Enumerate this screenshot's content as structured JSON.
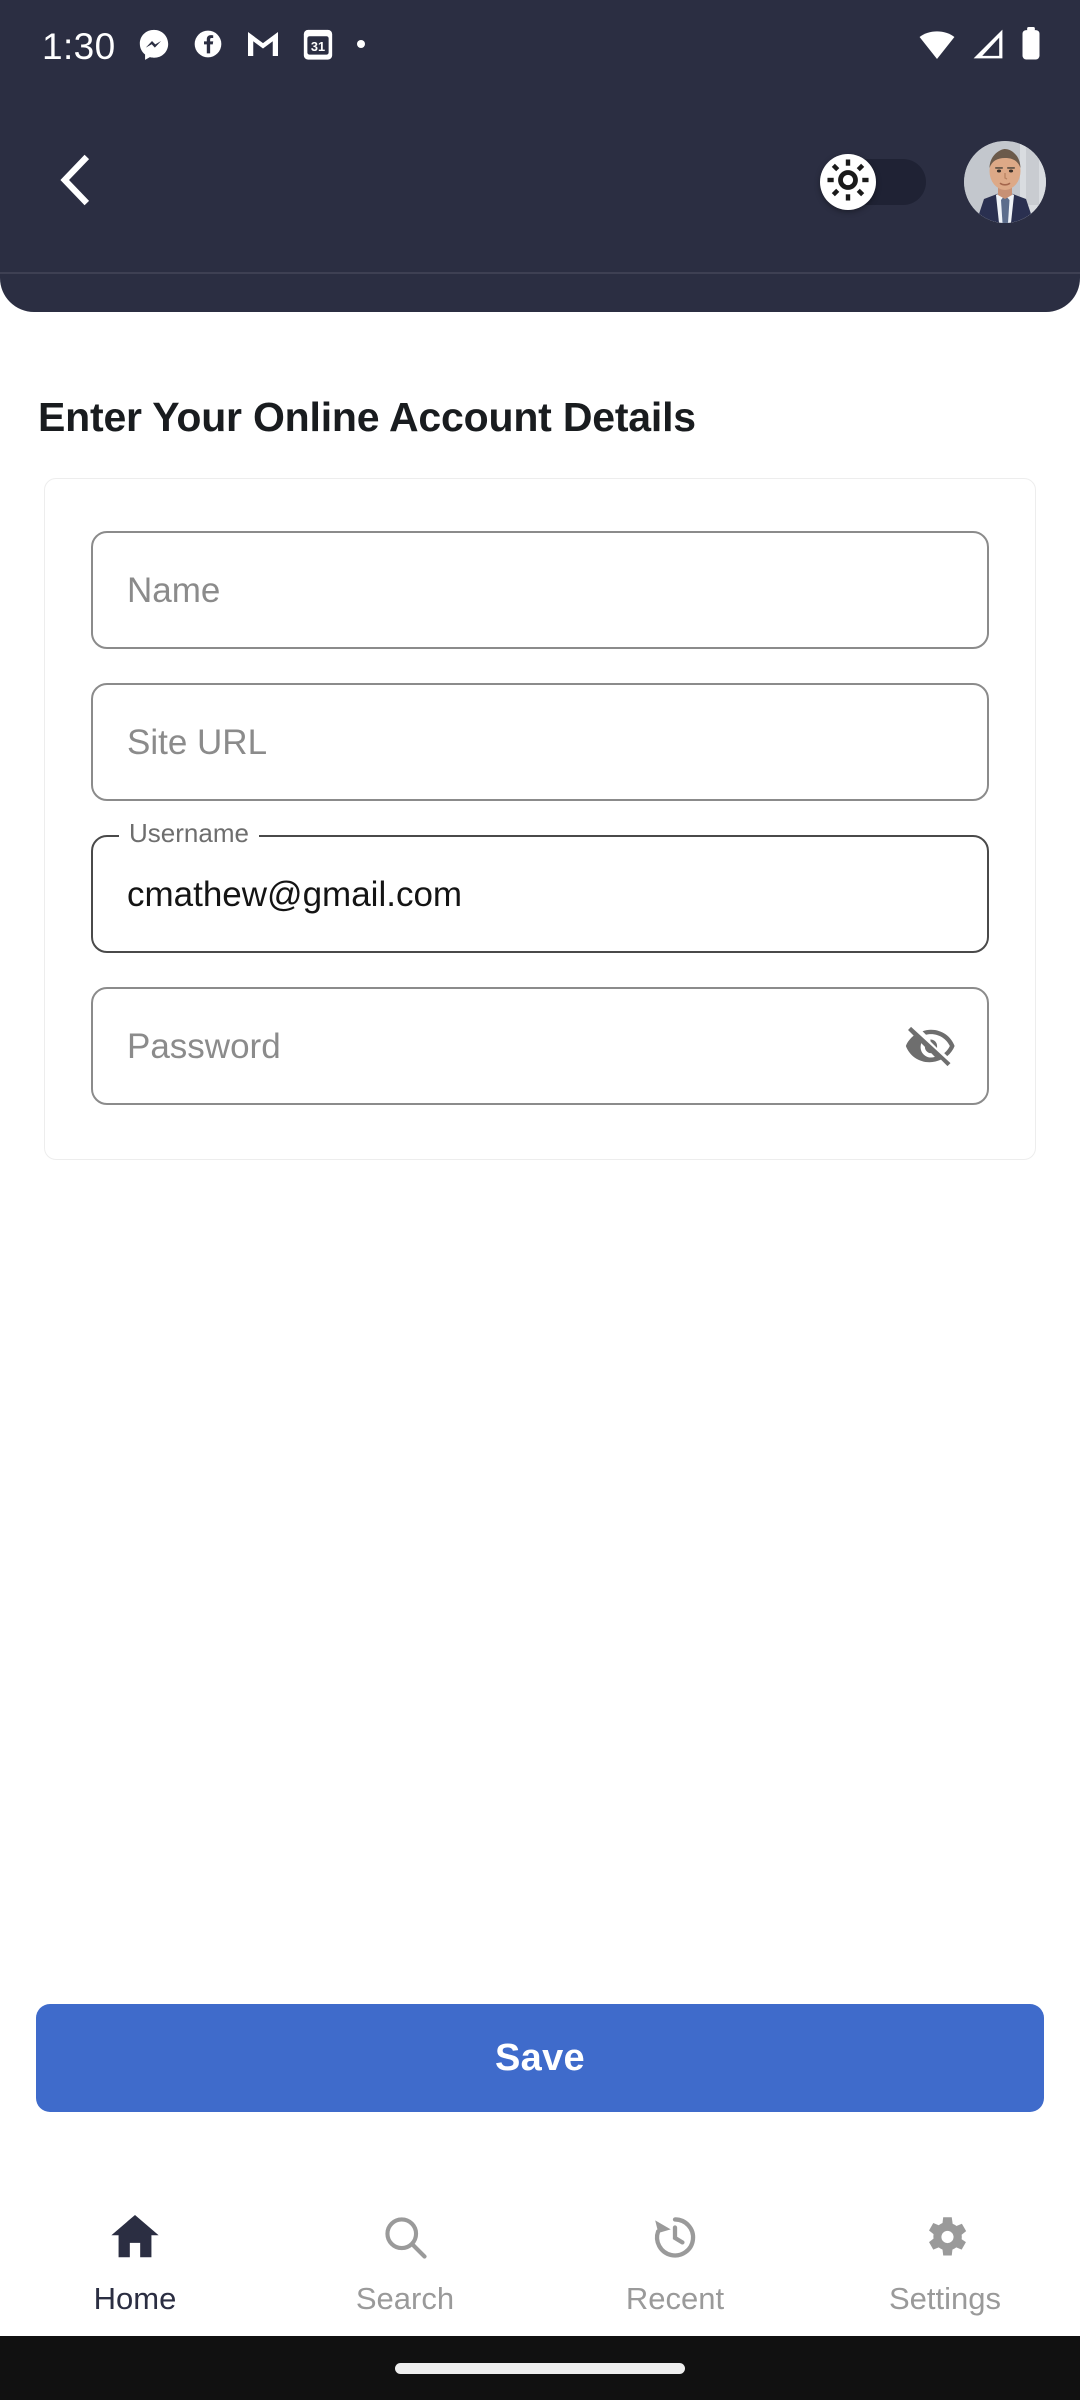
{
  "status_bar": {
    "time": "1:30",
    "left_icons": [
      "messenger-icon",
      "facebook-icon",
      "gmail-icon",
      "calendar-icon",
      "more-dot-icon"
    ],
    "calendar_day": "31",
    "right_icons": [
      "wifi-icon",
      "cellular-signal-icon",
      "battery-icon"
    ]
  },
  "app_bar": {
    "back_icon": "back-chevron-icon",
    "theme_toggle": {
      "icon": "brightness-sun-icon",
      "state": "off"
    },
    "avatar": "user-avatar"
  },
  "main": {
    "title": "Enter Your Online Account Details",
    "fields": [
      {
        "name": "name",
        "placeholder": "Name",
        "value": "",
        "label": "",
        "floating": false
      },
      {
        "name": "site-url",
        "placeholder": "Site URL",
        "value": "",
        "label": "",
        "floating": false
      },
      {
        "name": "username",
        "placeholder": "",
        "value": "cmathew@gmail.com",
        "label": "Username",
        "floating": true
      },
      {
        "name": "password",
        "placeholder": "Password",
        "value": "",
        "label": "",
        "floating": false,
        "trailing_icon": "visibility-off-icon"
      }
    ]
  },
  "actions": {
    "save_label": "Save"
  },
  "bottom_nav": {
    "items": [
      {
        "label": "Home",
        "icon": "home-icon",
        "active": true
      },
      {
        "label": "Search",
        "icon": "search-icon",
        "active": false
      },
      {
        "label": "Recent",
        "icon": "history-clock-icon",
        "active": false
      },
      {
        "label": "Settings",
        "icon": "gear-icon",
        "active": false
      }
    ]
  },
  "colors": {
    "header_bg": "#2b2e42",
    "accent_button": "#3f6bcb",
    "active_nav": "#2b2e42",
    "inactive_nav": "#9a9a9a",
    "field_border": "#8b8b8b",
    "placeholder": "#8b8b8b",
    "page_bg": "#ffffff",
    "gesture_bar": "#111111"
  }
}
